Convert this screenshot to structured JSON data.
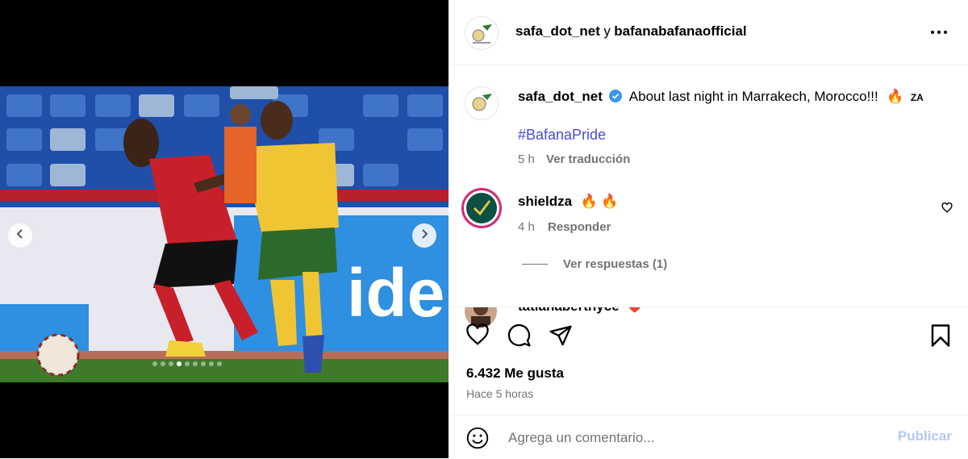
{
  "colors": {
    "link": "#4a4ad6",
    "muted": "#737373",
    "publish": "#b3c8f5",
    "verified": "#3897f0"
  },
  "media": {
    "dots_total": 9,
    "dots_active": 3,
    "prev_icon": "chevron-left-icon",
    "next_icon": "chevron-right-icon"
  },
  "header": {
    "account1": "safa_dot_net",
    "conjunction": "y",
    "account2": "bafanabafanaofficial",
    "more_icon": "more-horizontal-icon"
  },
  "caption": {
    "username": "safa_dot_net",
    "text": "About last night in Marrakech, Morocco!!!",
    "emoji": "🔥",
    "flag": "ZA",
    "hashtag": "#BafanaPride",
    "time": "5 h",
    "translate": "Ver traducción"
  },
  "comments": [
    {
      "username": "shieldza",
      "text": "🔥 🔥",
      "time": "4 h",
      "reply": "Responder",
      "view_replies": "Ver respuestas (1)"
    },
    {
      "username": "tatianaberthyce",
      "text": "❤️"
    }
  ],
  "actions": {
    "likes": "6.432 Me gusta",
    "posted": "Hace 5 horas"
  },
  "comment_box": {
    "placeholder": "Agrega un comentario...",
    "publish": "Publicar"
  }
}
